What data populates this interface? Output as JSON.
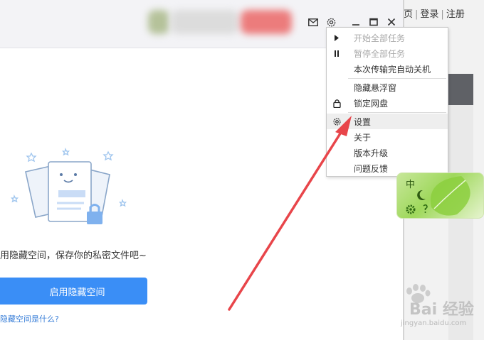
{
  "background_page": {
    "nav_partial": "页",
    "login": "登录",
    "register": "注册",
    "separator": "|"
  },
  "client": {
    "hidden_space_text": "用隐藏空间，保存你的私密文件吧~",
    "enable_button": "启用隐藏空间",
    "what_is_link": "隐藏空间是什么?"
  },
  "titlebar": {
    "icons": [
      "mail-icon",
      "settings-icon",
      "minimize-icon",
      "maximize-icon",
      "close-icon"
    ]
  },
  "menu": {
    "items": [
      {
        "label": "开始全部任务",
        "icon": "play-icon",
        "disabled": true
      },
      {
        "label": "暂停全部任务",
        "icon": "pause-icon",
        "disabled": true
      },
      {
        "label": "本次传输完自动关机",
        "icon": "",
        "disabled": false
      },
      {
        "label": "隐藏悬浮窗",
        "icon": "",
        "disabled": false
      },
      {
        "label": "锁定网盘",
        "icon": "lock-icon",
        "disabled": false
      },
      {
        "label": "设置",
        "icon": "gear-icon",
        "disabled": false,
        "highlighted": true
      },
      {
        "label": "关于",
        "icon": "",
        "disabled": false
      },
      {
        "label": "版本升级",
        "icon": "",
        "disabled": false
      },
      {
        "label": "问题反馈",
        "icon": "",
        "disabled": false
      }
    ]
  },
  "widget": {
    "label": "中"
  },
  "watermark": {
    "logo": "Bai  经验",
    "url": "jingyan.baidu.com"
  },
  "colors": {
    "primary_button": "#3a8ef6",
    "link": "#3a7fd8",
    "arrow": "#e8454a",
    "menu_disabled": "#a8a8a8"
  }
}
